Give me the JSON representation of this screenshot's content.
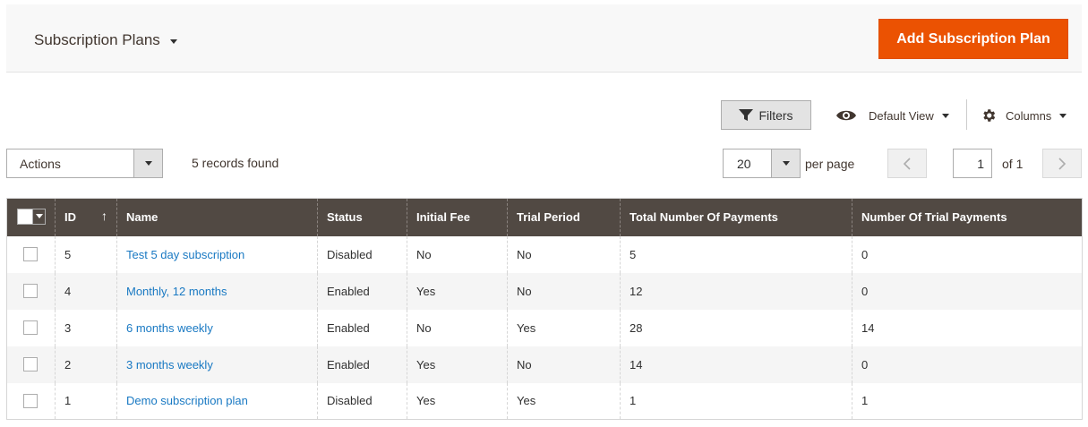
{
  "header": {
    "switcher_label": "Subscription Plans",
    "add_button_label": "Add Subscription Plan"
  },
  "toolbar": {
    "filters_label": "Filters",
    "view_label": "Default View",
    "columns_label": "Columns",
    "actions_label": "Actions",
    "records_text": "5 records found",
    "page_size": "20",
    "per_page_label": "per page",
    "current_page": "1",
    "of_pages": "of 1"
  },
  "grid": {
    "columns": [
      "ID",
      "Name",
      "Status",
      "Initial Fee",
      "Trial Period",
      "Total Number Of Payments",
      "Number Of Trial Payments"
    ],
    "sort_indicator": "↑",
    "rows": [
      {
        "id": "5",
        "name": "Test 5 day subscription",
        "status": "Disabled",
        "initial_fee": "No",
        "trial_period": "No",
        "total_payments": "5",
        "trial_payments": "0"
      },
      {
        "id": "4",
        "name": "Monthly, 12 months",
        "status": "Enabled",
        "initial_fee": "Yes",
        "trial_period": "No",
        "total_payments": "12",
        "trial_payments": "0"
      },
      {
        "id": "3",
        "name": "6 months weekly",
        "status": "Enabled",
        "initial_fee": "No",
        "trial_period": "Yes",
        "total_payments": "28",
        "trial_payments": "14"
      },
      {
        "id": "2",
        "name": "3 months weekly",
        "status": "Enabled",
        "initial_fee": "Yes",
        "trial_period": "No",
        "total_payments": "14",
        "trial_payments": "0"
      },
      {
        "id": "1",
        "name": "Demo subscription plan",
        "status": "Disabled",
        "initial_fee": "Yes",
        "trial_period": "Yes",
        "total_payments": "1",
        "trial_payments": "1"
      }
    ]
  },
  "colors": {
    "accent": "#eb5202",
    "grid_header": "#514943",
    "link": "#1979c3"
  },
  "icons": {
    "filters": "funnel-icon",
    "view": "eye-icon",
    "columns": "gear-icon",
    "prev": "chevron-left-icon",
    "next": "chevron-right-icon"
  }
}
